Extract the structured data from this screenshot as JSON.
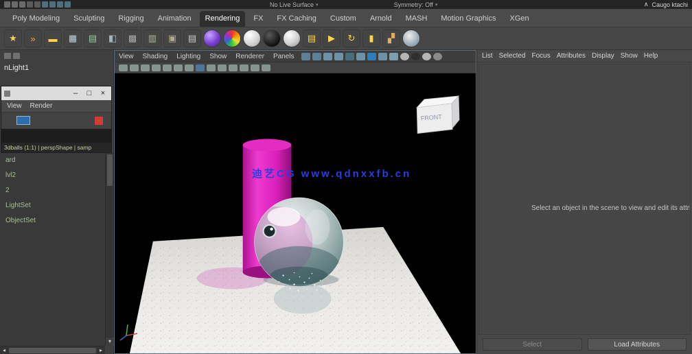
{
  "colors": {
    "accent_blue": "#2e7cb8",
    "magenta": "#e322c8",
    "watermark_blue": "#2b3de0",
    "stop_red": "#d23b2f",
    "panel_gray": "#484848"
  },
  "status_bar": {
    "icons": [
      {
        "name": "new-scene-icon",
        "bg": "#6a6a6a"
      },
      {
        "name": "open-scene-icon",
        "bg": "#6a6a6a"
      },
      {
        "name": "save-scene-icon",
        "bg": "#6a6a6a"
      },
      {
        "name": "undo-icon",
        "bg": "#5a5a5a"
      },
      {
        "name": "redo-icon",
        "bg": "#5a5a5a"
      },
      {
        "name": "snap-grid-icon",
        "bg": "#4f6f7f"
      },
      {
        "name": "snap-curve-icon",
        "bg": "#4f6f7f"
      },
      {
        "name": "snap-point-icon",
        "bg": "#4f6f7f"
      },
      {
        "name": "snap-plane-icon",
        "bg": "#4f6f7f"
      }
    ],
    "no_live_surface": "No Live Surface",
    "symmetry_label": "Symmetry: Off",
    "caret": "∧",
    "right_text": "Caugo ktachi"
  },
  "shelf_tabs": [
    {
      "label": "Poly Modeling"
    },
    {
      "label": "Sculpting"
    },
    {
      "label": "Rigging"
    },
    {
      "label": "Animation"
    },
    {
      "label": "Rendering",
      "active": true
    },
    {
      "label": "FX"
    },
    {
      "label": "FX Caching"
    },
    {
      "label": "Custom"
    },
    {
      "label": "Arnold"
    },
    {
      "label": "MASH"
    },
    {
      "label": "Motion Graphics"
    },
    {
      "label": "XGen"
    }
  ],
  "shelf": {
    "icons": [
      {
        "name": "point-light-icon",
        "glyph": "★",
        "glyph_color": "#ffd34d"
      },
      {
        "name": "spot-light-icon",
        "glyph": "»",
        "glyph_color": "#ff9d3a"
      },
      {
        "name": "area-light-icon",
        "glyph": "▬",
        "glyph_color": "#ffd34d"
      },
      {
        "name": "render-view-grid-icon",
        "glyph": "▦",
        "glyph_color": "#bcd2dc"
      },
      {
        "name": "light-editor-icon",
        "glyph": "▤",
        "glyph_color": "#8fd09a"
      },
      {
        "name": "hypershade-icon",
        "glyph": "◧",
        "glyph_color": "#9fb4c0"
      },
      {
        "name": "shading-map-icon",
        "glyph": "▩",
        "glyph_color": "#a8a8b0"
      },
      {
        "name": "uv-editor-icon",
        "glyph": "▥",
        "glyph_color": "#a8b8a0"
      },
      {
        "name": "texture-view-icon",
        "glyph": "▣",
        "glyph_color": "#b0a890"
      },
      {
        "name": "render-layers-icon",
        "glyph": "▤",
        "glyph_color": "#c9c9c9"
      },
      {
        "name": "maya-software-sphere-icon",
        "bg": "radial-gradient(circle at 35% 30%, #caa2ff, #7a3fd0 55%, #41208c)",
        "shape": "circle"
      },
      {
        "name": "rainbow-shader-sphere-icon",
        "bg": "conic-gradient(#e33, #e90, #ed3, #3c3, #36c, #93c, #e33)",
        "shape": "circle"
      },
      {
        "name": "white-shader-sphere-icon",
        "bg": "radial-gradient(circle at 35% 30%, #ffffff, #d5d5d5 55%, #9c9c9c)",
        "shape": "circle"
      },
      {
        "name": "black-shader-sphere-icon",
        "bg": "radial-gradient(circle at 35% 30%, #5a5a5a, #101010 70%)",
        "shape": "circle"
      },
      {
        "name": "blinn-shader-sphere-icon",
        "bg": "radial-gradient(circle at 35% 30%, #ffffff, #cfcfcf 55%, #8f8f8f)",
        "shape": "circle"
      },
      {
        "name": "render-settings-icon",
        "glyph": "▤",
        "glyph_color": "#ffd34d"
      },
      {
        "name": "render-current-frame-icon",
        "glyph": "▶",
        "glyph_color": "#ffd34d"
      },
      {
        "name": "ipr-render-icon",
        "glyph": "↻",
        "glyph_color": "#ffd34d"
      },
      {
        "name": "batch-render-icon",
        "glyph": "▮",
        "glyph_color": "#ffd34d"
      },
      {
        "name": "paint-effects-icon",
        "glyph": "▞",
        "glyph_color": "#e0b060"
      },
      {
        "name": "textured-sphere-icon",
        "bg": "radial-gradient(circle at 40% 35%, #eeeeee, #8fa0ae 70%)",
        "shape": "circle"
      }
    ]
  },
  "left_panel": {
    "top_icons": [
      {
        "name": "panel-menu-icon",
        "bg": "#707070"
      },
      {
        "name": "panel-filter-icon",
        "bg": "#707070"
      }
    ],
    "light_label": "nLight1",
    "render_window": {
      "title": "",
      "controls": {
        "minimize": "–",
        "maximize": "□",
        "close": "×"
      },
      "menu": [
        "View",
        "Render"
      ],
      "info_bar": "3dballs (1:1) | perspShape | samp"
    },
    "outliner_items": [
      "ard",
      "lvl2",
      "2",
      "LightSet",
      "ObjectSet"
    ]
  },
  "viewport": {
    "menu": [
      "View",
      "Shading",
      "Lighting",
      "Show",
      "Renderer",
      "Panels"
    ],
    "bar_icons": [
      {
        "name": "grid-toggle-icon",
        "bg": "#5d8096"
      },
      {
        "name": "film-gate-icon",
        "bg": "#5d8096"
      },
      {
        "name": "resolution-gate-icon",
        "bg": "#6b93a8"
      },
      {
        "name": "gate-mask-icon",
        "bg": "#6b93a8"
      },
      {
        "name": "field-chart-icon",
        "bg": "#44707e"
      },
      {
        "name": "safe-action-icon",
        "bg": "#6b93a8"
      },
      {
        "name": "wireframe-on-shaded-icon",
        "bg": "#2e7cb8"
      },
      {
        "name": "default-material-icon",
        "bg": "#6b93a8"
      },
      {
        "name": "xray-icon",
        "bg": "#7b9fae"
      },
      {
        "name": "shading-smooth-icon",
        "bg": "#b5b5b5",
        "shape": "circle"
      },
      {
        "name": "shading-flat-icon",
        "bg": "#2f2f2f",
        "shape": "circle"
      },
      {
        "name": "shading-points-icon",
        "bg": "#b5b5b5",
        "shape": "circle"
      },
      {
        "name": "lighting-toggle-icon",
        "bg": "#8a8a8a",
        "shape": "circle"
      }
    ],
    "toolbar_icons": [
      {
        "name": "select-camera-icon",
        "bg": "#8fa39a"
      },
      {
        "name": "lock-camera-icon",
        "bg": "#8fa39a"
      },
      {
        "name": "camera-attributes-icon",
        "bg": "#8fa39a"
      },
      {
        "name": "bookmark-icon",
        "bg": "#8fa39a"
      },
      {
        "name": "image-plane-icon",
        "bg": "#8fa39a"
      },
      {
        "name": "pan-zoom-icon",
        "bg": "#8fa39a"
      },
      {
        "name": "oversampling-icon",
        "bg": "#8fa39a"
      },
      {
        "name": "isolate-select-icon",
        "bg": "#4f7fae"
      },
      {
        "name": "wireframe-icon",
        "bg": "#8fa39a"
      },
      {
        "name": "smooth-shade-icon",
        "bg": "#8fa39a"
      },
      {
        "name": "textured-icon",
        "bg": "#8fa39a"
      },
      {
        "name": "use-all-lights-icon",
        "bg": "#8fa39a"
      },
      {
        "name": "shadows-icon",
        "bg": "#8fa39a"
      },
      {
        "name": "screen-ao-icon",
        "bg": "#8fa39a"
      }
    ],
    "watermark": "迪艺CG www.qdnxxfb.cn",
    "front_label": "FRONT"
  },
  "attribute_editor": {
    "menu": [
      "List",
      "Selected",
      "Focus",
      "Attributes",
      "Display",
      "Show",
      "Help"
    ],
    "empty_message": "Select an object in the scene to view and edit its attributes.",
    "select_button": "Select",
    "load_attributes_button": "Load Attributes"
  }
}
